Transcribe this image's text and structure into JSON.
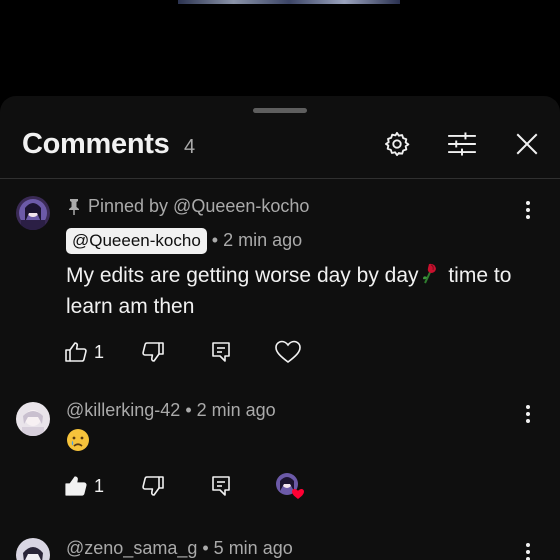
{
  "header": {
    "title": "Comments",
    "count": "4"
  },
  "comments": [
    {
      "pinned_by": "Pinned by @Queeen-kocho",
      "author": "@Queeen-kocho",
      "time": "• 2 min ago",
      "text_before_emoji": "My edits are getting worse day by day",
      "emoji": "rose-wilted",
      "text_after_emoji": " time to learn am then",
      "likes": "1"
    },
    {
      "author": "@killerking-42",
      "time": "• 2 min ago",
      "text_emoji": "crying-face",
      "likes": "1",
      "liked": true,
      "creator_heart": true
    },
    {
      "author": "@zeno_sama_g",
      "time": "• 5 min ago"
    }
  ],
  "colors": {
    "sheet_bg": "#0f0f0f",
    "text": "#f1f1f1",
    "secondary": "#aaaaaa",
    "heart": "#ff0033"
  }
}
